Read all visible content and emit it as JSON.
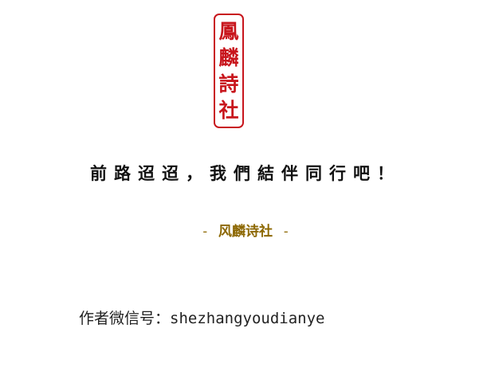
{
  "seal": {
    "chars": [
      "鳳",
      "麟",
      "詩",
      "社"
    ],
    "color": "#c8161d"
  },
  "headline": "前路迢迢，我們結伴同行吧！",
  "signature": {
    "dash_left": "-",
    "name": "风麟诗社",
    "dash_right": "-",
    "color": "#8c6700"
  },
  "wechat": {
    "label": "作者微信号：",
    "id": "shezhangyoudianye"
  }
}
